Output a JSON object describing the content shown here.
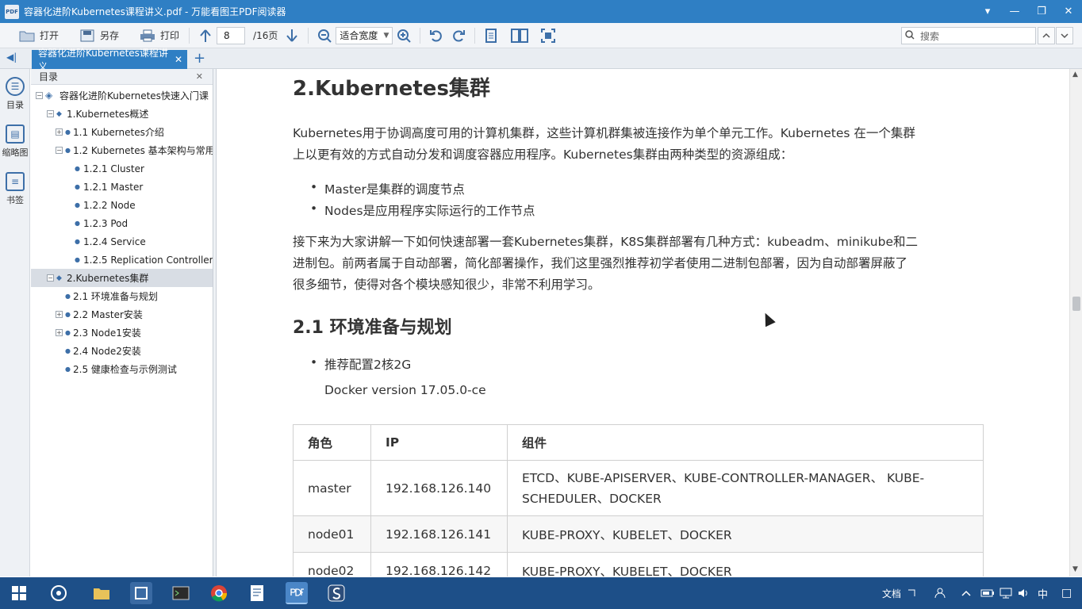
{
  "window": {
    "title": "容器化进阶Kubernetes课程讲义.pdf - 万能看图王PDF阅读器",
    "app_icon_text": "PDF",
    "min": "▾",
    "minimize": "—",
    "restore": "❐",
    "close": "✕"
  },
  "toolbar": {
    "open_label": "打开",
    "saveas_label": "另存",
    "print_label": "打印",
    "page_current": "8",
    "page_total": "/16页",
    "zoom_value": "适合宽度",
    "search_placeholder": "搜索"
  },
  "tabs": {
    "doc_tab_label": "容器化进阶Kubernetes课程讲义",
    "close": "✕",
    "add": "+"
  },
  "sidestrip": {
    "outline_label": "目录",
    "thumbs_label": "缩略图",
    "bookmarks_label": "书签"
  },
  "outline": {
    "header": "目录",
    "items": [
      {
        "label": "容器化进阶Kubernetes快速入门课"
      },
      {
        "label": "1.Kubernetes概述"
      },
      {
        "label": "1.1 Kubernetes介绍"
      },
      {
        "label": "1.2 Kubernetes 基本架构与常用"
      },
      {
        "label": "1.2.1 Cluster"
      },
      {
        "label": "1.2.1 Master"
      },
      {
        "label": "1.2.2 Node"
      },
      {
        "label": "1.2.3 Pod"
      },
      {
        "label": "1.2.4 Service"
      },
      {
        "label": "1.2.5 Replication Controller"
      },
      {
        "label": "2.Kubernetes集群"
      },
      {
        "label": "2.1 环境准备与规划"
      },
      {
        "label": "2.2 Master安装"
      },
      {
        "label": "2.3 Node1安装"
      },
      {
        "label": "2.4 Node2安装"
      },
      {
        "label": "2.5 健康检查与示例测试"
      }
    ]
  },
  "document": {
    "heading": "2.Kubernetes集群",
    "intro_line1": "Kubernetes用于协调高度可用的计算机集群，这些计算机群集被连接作为单个单元工作。Kubernetes 在一个集群",
    "intro_line2": "上以更有效的方式自动分发和调度容器应用程序。Kubernetes集群由两种类型的资源组成：",
    "bullet1": "Master是集群的调度节点",
    "bullet2": "Nodes是应用程序实际运行的工作节点",
    "para2_line1": "接下来为大家讲解一下如何快速部署一套Kubernetes集群，K8S集群部署有几种方式：kubeadm、minikube和二",
    "para2_line2": "进制包。前两者属于自动部署，简化部署操作，我们这里强烈推荐初学者使用二进制包部署，因为自动部署屏蔽了",
    "para2_line3": "很多细节，使得对各个模块感知很少，非常不利用学习。",
    "heading2": "2.1 环境准备与规划",
    "bullet3": "推荐配置2核2G",
    "docker_version": "Docker version 17.05.0-ce",
    "table": {
      "headers": [
        "角色",
        "IP",
        "组件"
      ],
      "rows": [
        {
          "role": "master",
          "ip": "192.168.126.140",
          "components_l1": "ETCD、KUBE-APISERVER、KUBE-CONTROLLER-MANAGER、 KUBE-",
          "components_l2": "SCHEDULER、DOCKER"
        },
        {
          "role": "node01",
          "ip": "192.168.126.141",
          "components": "KUBE-PROXY、KUBELET、DOCKER"
        },
        {
          "role": "node02",
          "ip": "192.168.126.142",
          "components": "KUBE-PROXY、KUBELET、DOCKER"
        }
      ]
    }
  },
  "taskbar": {
    "doc_label": "文档",
    "ime": "中",
    "notifications": "□"
  },
  "colors": {
    "titlebar": "#2f7fc4",
    "taskbar": "#1d4f88",
    "selected_row": "#d8dde4"
  }
}
